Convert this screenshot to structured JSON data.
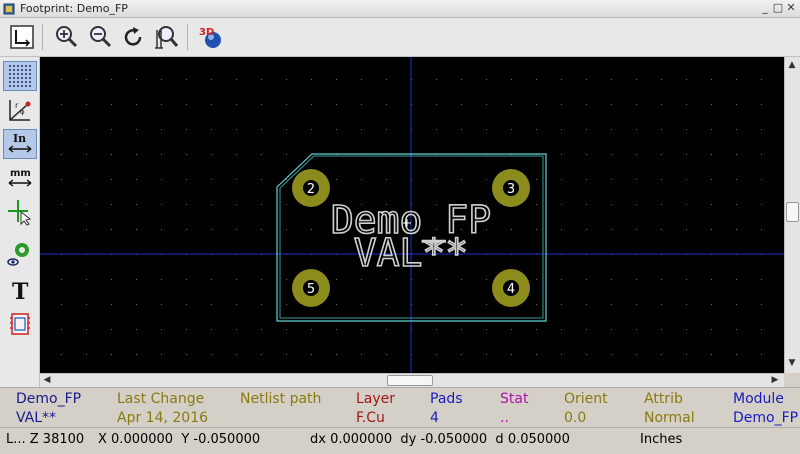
{
  "window": {
    "title": "Footprint: Demo_FP",
    "minimize_glyph": "_",
    "maximize_glyph": "□",
    "close_glyph": "✕"
  },
  "toolbar": {
    "buttons": [
      {
        "name": "show-board-button",
        "icon": "board-icon"
      },
      {
        "name": "zoom-in-button",
        "icon": "zoom-in-icon"
      },
      {
        "name": "zoom-out-button",
        "icon": "zoom-out-icon"
      },
      {
        "name": "redraw-button",
        "icon": "redraw-icon"
      },
      {
        "name": "zoom-fit-button",
        "icon": "zoom-fit-icon"
      },
      {
        "name": "3d-viewer-button",
        "icon": "3d-icon",
        "label": "3D"
      }
    ]
  },
  "left_toolbar": {
    "buttons": [
      {
        "name": "grid-toggle-button",
        "icon": "grid-icon",
        "active": true
      },
      {
        "name": "polar-coords-button",
        "icon": "polar-icon",
        "label": "r θ"
      },
      {
        "name": "units-inch-button",
        "icon": "inch-icon",
        "label": "In",
        "active": true
      },
      {
        "name": "units-mm-button",
        "icon": "mm-icon",
        "label": "mm"
      },
      {
        "name": "cursor-shape-button",
        "icon": "cursor-icon"
      },
      {
        "name": "pad-sketch-button",
        "icon": "pad-view-icon"
      },
      {
        "name": "text-sketch-button",
        "icon": "text-icon",
        "label": "T"
      },
      {
        "name": "module-edges-button",
        "icon": "module-edges-icon"
      }
    ]
  },
  "canvas": {
    "footprint_name": "Demo_FP",
    "footprint_value": "VAL**",
    "pads": [
      "2",
      "3",
      "5",
      "4"
    ],
    "colors": {
      "background": "#000000",
      "grid_dots": "#6a6a6a",
      "axis": "#1a2fd6",
      "outline": "#5fd0d0",
      "pad": "#8c8c1c",
      "text": "#d0d0d0"
    }
  },
  "info_panel": {
    "columns": [
      {
        "label": "Demo_FP",
        "value": "VAL**",
        "label_color": "#1a1a8c",
        "value_color": "#1a1a8c"
      },
      {
        "label": "Last Change",
        "value": "Apr 14, 2016",
        "label_color": "#8a7a10",
        "value_color": "#8a7a10"
      },
      {
        "label": "Netlist path",
        "value": "",
        "label_color": "#8a7a10",
        "value_color": "#8a7a10"
      },
      {
        "label": "Layer",
        "value": "F.Cu",
        "label_color": "#a01818",
        "value_color": "#a01818"
      },
      {
        "label": "Pads",
        "value": "4",
        "label_color": "#1a1ac0",
        "value_color": "#1a1ac0"
      },
      {
        "label": "Stat",
        "value": "..",
        "label_color": "#b010b0",
        "value_color": "#b010b0"
      },
      {
        "label": "Orient",
        "value": "0.0",
        "label_color": "#8a7a10",
        "value_color": "#8a7a10"
      },
      {
        "label": "Attrib",
        "value": "Normal",
        "label_color": "#8a7a10",
        "value_color": "#8a7a10"
      },
      {
        "label": "Module",
        "value": "Demo_FP",
        "label_color": "#1a1ac0",
        "value_color": "#1a1ac0"
      }
    ]
  },
  "status_bar": {
    "zoom": "L... Z 38100",
    "abs_coords": "X 0.000000  Y -0.050000",
    "rel_coords": "dx 0.000000  dy -0.050000  d 0.050000",
    "units": "Inches"
  },
  "scrollbars": {
    "up_glyph": "▲",
    "down_glyph": "▼",
    "left_glyph": "◀",
    "right_glyph": "▶"
  }
}
